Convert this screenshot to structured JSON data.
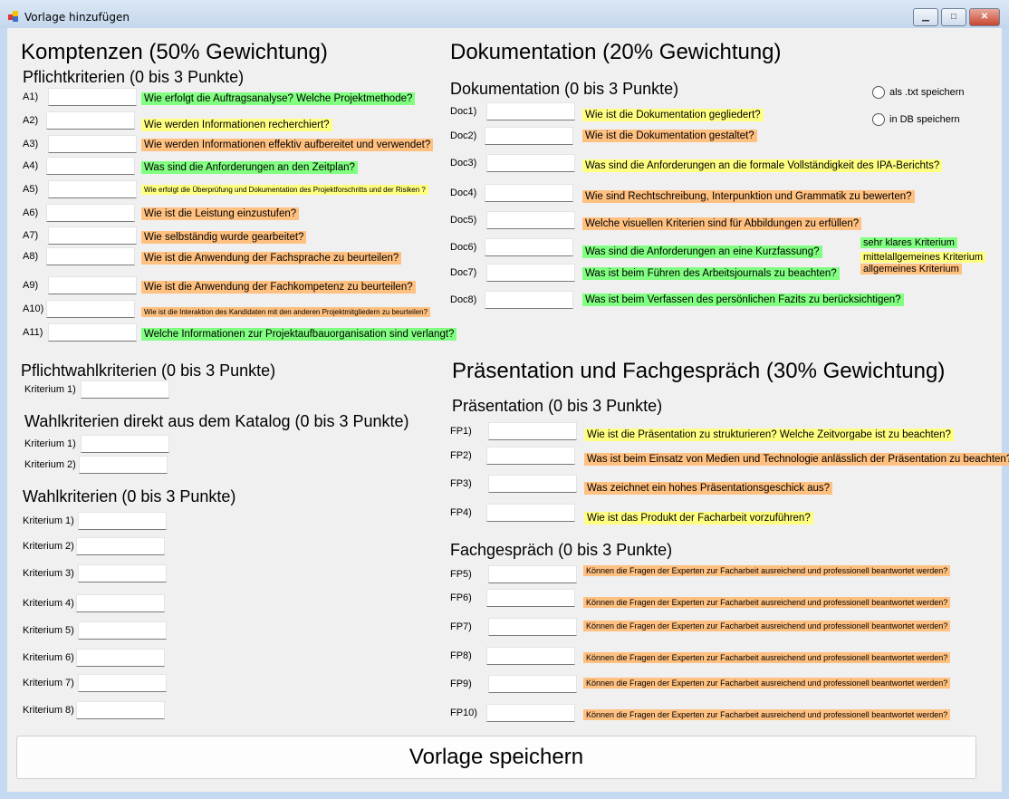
{
  "window": {
    "title": "Vorlage hinzufügen",
    "minimize": "▁",
    "maximize": "□",
    "close": "✕"
  },
  "colors": {
    "sehr_klar": "#80ff80",
    "mittelallgemein": "#ffff80",
    "allgemein": "#ffc080"
  },
  "kompetenzen": {
    "heading": "Komptenzen (50% Gewichtung)",
    "pflicht_heading": "Pflichtkriterien (0 bis 3 Punkte)",
    "rows": [
      {
        "label": "A1)",
        "value": "",
        "question": "Wie erfolgt die Auftragsanalyse? Welche Projektmethode?",
        "category": "green"
      },
      {
        "label": "A2)",
        "value": "",
        "question": "Wie werden Informationen recherchiert?",
        "category": "yellow"
      },
      {
        "label": "A3)",
        "value": "",
        "question": "Wie werden Informationen effektiv aufbereitet und verwendet?",
        "category": "orange"
      },
      {
        "label": "A4)",
        "value": "",
        "question": "Was sind die Anforderungen an den Zeitplan?",
        "category": "green"
      },
      {
        "label": "A5)",
        "value": "",
        "question": "Wie erfolgt die Überprüfung und Dokumentation des Projektforschritts und der Risiken ?",
        "category": "yellow"
      },
      {
        "label": "A6)",
        "value": "",
        "question": "Wie ist die Leistung einzustufen?",
        "category": "orange"
      },
      {
        "label": "A7)",
        "value": "",
        "question": "Wie selbständig wurde gearbeitet?",
        "category": "orange"
      },
      {
        "label": "A8)",
        "value": "",
        "question": "Wie ist die Anwendung der Fachsprache zu beurteilen?",
        "category": "orange"
      },
      {
        "label": "A9)",
        "value": "",
        "question": "Wie ist die Anwendung der Fachkompetenz zu beurteilen?",
        "category": "orange"
      },
      {
        "label": "A10)",
        "value": "",
        "question": "Wie ist die Interaktion des Kandidaten mit den anderen Projektmitgliedern zu beurteilen?",
        "category": "orange"
      },
      {
        "label": "A11)",
        "value": "",
        "question": "Welche Informationen zur Projektaufbauorganisation sind verlangt?",
        "category": "green"
      }
    ],
    "pflichtwahl_heading": "Pflichtwahlkriterien (0 bis 3 Punkte)",
    "pflichtwahl": [
      {
        "label": "Kriterium 1)",
        "value": ""
      }
    ],
    "katalog_heading": "Wahlkriterien direkt aus dem Katalog (0 bis 3 Punkte)",
    "katalog": [
      {
        "label": "Kriterium 1)",
        "value": ""
      },
      {
        "label": "Kriterium 2)",
        "value": ""
      }
    ],
    "wahl_heading": "Wahlkriterien (0 bis 3 Punkte)",
    "wahl": [
      {
        "label": "Kriterium 1)",
        "value": ""
      },
      {
        "label": "Kriterium 2)",
        "value": ""
      },
      {
        "label": "Kriterium 3)",
        "value": ""
      },
      {
        "label": "Kriterium 4)",
        "value": ""
      },
      {
        "label": "Kriterium 5)",
        "value": ""
      },
      {
        "label": "Kriterium 6)",
        "value": ""
      },
      {
        "label": "Kriterium 7)",
        "value": ""
      },
      {
        "label": "Kriterium 8)",
        "value": ""
      }
    ]
  },
  "dokumentation": {
    "heading": "Dokumentation (20% Gewichtung)",
    "sub_heading": "Dokumentation (0 bis 3 Punkte)",
    "rows": [
      {
        "label": "Doc1)",
        "value": "",
        "question": "Wie ist die Dokumentation gegliedert?",
        "category": "yellow"
      },
      {
        "label": "Doc2)",
        "value": "",
        "question": "Wie ist die Dokumentation gestaltet?",
        "category": "orange"
      },
      {
        "label": "Doc3)",
        "value": "",
        "question": "Was sind die Anforderungen an die formale Vollständigkeit des IPA-Berichts?",
        "category": "yellow"
      },
      {
        "label": "Doc4)",
        "value": "",
        "question": "Wie sind Rechtschreibung, Interpunktion und Grammatik zu bewerten?",
        "category": "orange"
      },
      {
        "label": "Doc5)",
        "value": "",
        "question": "Welche visuellen Kriterien sind für Abbildungen zu erfüllen?",
        "category": "orange"
      },
      {
        "label": "Doc6)",
        "value": "",
        "question": "Was sind die Anforderungen an eine Kurzfassung?",
        "category": "green"
      },
      {
        "label": "Doc7)",
        "value": "",
        "question": "Was ist beim Führen des Arbeitsjournals zu beachten?",
        "category": "green"
      },
      {
        "label": "Doc8)",
        "value": "",
        "question": "Was ist beim Verfassen des persönlichen Fazits zu berücksichtigen?",
        "category": "green"
      }
    ]
  },
  "speichern_optionen": [
    {
      "label": "als .txt speichern",
      "checked": false
    },
    {
      "label": "in DB speichern",
      "checked": false
    }
  ],
  "legende": [
    {
      "label": "sehr klares Kriterium",
      "category": "green"
    },
    {
      "label": "mittelallgemeines Kriterium",
      "category": "yellow"
    },
    {
      "label": "allgemeines Kriterium",
      "category": "orange"
    }
  ],
  "praesentation": {
    "heading": "Präsentation und Fachgespräch (30% Gewichtung)",
    "sub_heading": "Präsentation (0 bis 3 Punkte)",
    "rows": [
      {
        "label": "FP1)",
        "value": "",
        "question": "Wie ist die Präsentation zu strukturieren? Welche Zeitvorgabe ist zu beachten?",
        "category": "yellow"
      },
      {
        "label": "FP2)",
        "value": "",
        "question": "Was ist beim Einsatz von Medien und Technologie anlässlich der Präsentation zu beachten?",
        "category": "orange"
      },
      {
        "label": "FP3)",
        "value": "",
        "question": "Was zeichnet ein hohes Präsentationsgeschick aus?",
        "category": "orange"
      },
      {
        "label": "FP4)",
        "value": "",
        "question": "Wie ist das Produkt der Facharbeit vorzuführen?",
        "category": "yellow"
      }
    ],
    "fach_heading": "Fachgespräch (0 bis 3 Punkte)",
    "fach_rows": [
      {
        "label": "FP5)",
        "value": "",
        "question": "Können die Fragen der Experten zur Facharbeit ausreichend und professionell beantwortet werden?",
        "category": "orange"
      },
      {
        "label": "FP6)",
        "value": "",
        "question": "Können die Fragen der Experten zur Facharbeit ausreichend und professionell beantwortet werden?",
        "category": "orange"
      },
      {
        "label": "FP7)",
        "value": "",
        "question": "Können die Fragen der Experten zur Facharbeit ausreichend und professionell beantwortet werden?",
        "category": "orange"
      },
      {
        "label": "FP8)",
        "value": "",
        "question": "Können die Fragen der Experten zur Facharbeit ausreichend und professionell beantwortet werden?",
        "category": "orange"
      },
      {
        "label": "FP9)",
        "value": "",
        "question": "Können die Fragen der Experten zur Facharbeit ausreichend und professionell beantwortet werden?",
        "category": "orange"
      },
      {
        "label": "FP10)",
        "value": "",
        "question": "Können die Fragen der Experten zur Facharbeit ausreichend und professionell beantwortet werden?",
        "category": "orange"
      }
    ]
  },
  "save_button": "Vorlage speichern"
}
